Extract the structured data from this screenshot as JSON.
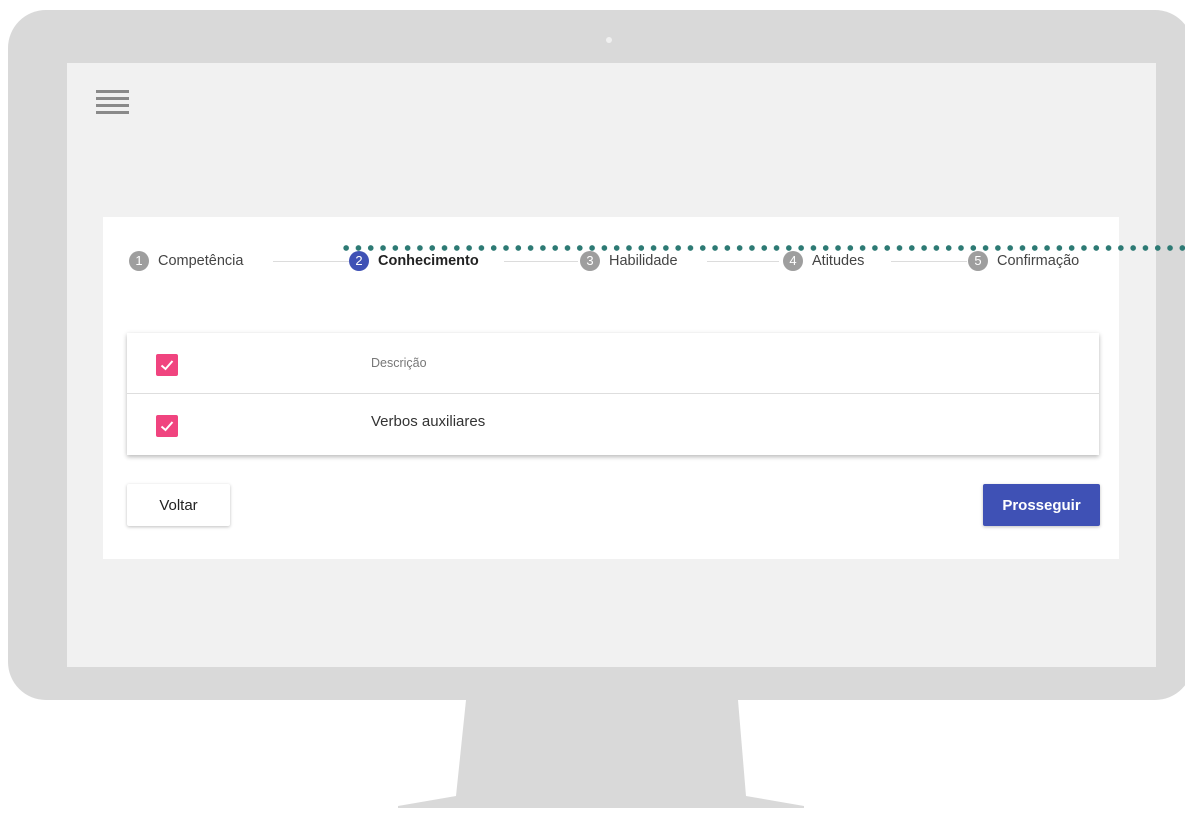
{
  "stepper": {
    "steps": [
      {
        "number": "1",
        "label": "Competência",
        "active": false
      },
      {
        "number": "2",
        "label": "Conhecimento",
        "active": true
      },
      {
        "number": "3",
        "label": "Habilidade",
        "active": false
      },
      {
        "number": "4",
        "label": "Atitudes",
        "active": false
      },
      {
        "number": "5",
        "label": "Confirmação",
        "active": false
      }
    ]
  },
  "table": {
    "header": {
      "checked": true,
      "column": "Descrição"
    },
    "rows": [
      {
        "checked": true,
        "description": "Verbos auxiliares"
      }
    ]
  },
  "actions": {
    "back_label": "Voltar",
    "next_label": "Prosseguir"
  },
  "colors": {
    "primary": "#3f51b5",
    "checkbox": "#f0447f",
    "dots": "#2d7a74",
    "inactive_step": "#9e9e9e"
  },
  "icons": {
    "menu": "hamburger-menu-icon",
    "check": "checkmark-icon"
  }
}
